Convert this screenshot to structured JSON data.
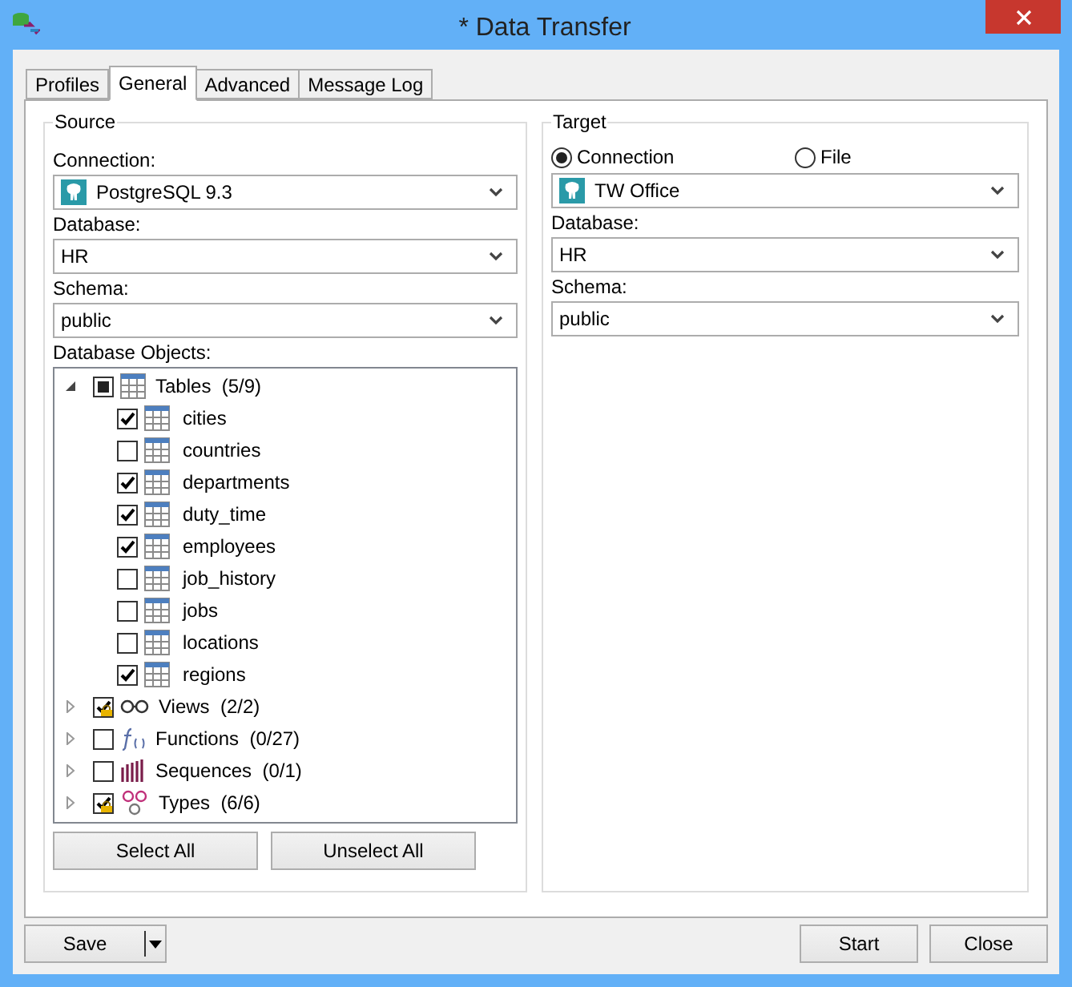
{
  "window": {
    "title": "* Data Transfer"
  },
  "tabs": [
    {
      "label": "Profiles",
      "selected": false
    },
    {
      "label": "General",
      "selected": true
    },
    {
      "label": "Advanced",
      "selected": false
    },
    {
      "label": "Message Log",
      "selected": false
    }
  ],
  "source": {
    "title": "Source",
    "connection_label": "Connection:",
    "connection": "PostgreSQL 9.3",
    "database_label": "Database:",
    "database": "HR",
    "schema_label": "Schema:",
    "schema": "public",
    "objects_label": "Database Objects:",
    "tree": [
      {
        "label": "Tables",
        "count": "(5/9)",
        "kind": "table",
        "checked": false,
        "partial": true,
        "locked": false,
        "expanded": true,
        "children": [
          {
            "label": "cities",
            "checked": true
          },
          {
            "label": "countries",
            "checked": false
          },
          {
            "label": "departments",
            "checked": true
          },
          {
            "label": "duty_time",
            "checked": true
          },
          {
            "label": "employees",
            "checked": true
          },
          {
            "label": "job_history",
            "checked": false
          },
          {
            "label": "jobs",
            "checked": false
          },
          {
            "label": "locations",
            "checked": false
          },
          {
            "label": "regions",
            "checked": true
          }
        ]
      },
      {
        "label": "Views",
        "count": "(2/2)",
        "kind": "view",
        "checked": true,
        "partial": false,
        "locked": true,
        "expanded": false
      },
      {
        "label": "Functions",
        "count": "(0/27)",
        "kind": "function",
        "checked": false,
        "partial": false,
        "locked": false,
        "expanded": false
      },
      {
        "label": "Sequences",
        "count": "(0/1)",
        "kind": "sequence",
        "checked": false,
        "partial": false,
        "locked": false,
        "expanded": false
      },
      {
        "label": "Types",
        "count": "(6/6)",
        "kind": "type",
        "checked": true,
        "partial": false,
        "locked": true,
        "expanded": false
      }
    ],
    "buttons": [
      "Select All",
      "Unselect All"
    ]
  },
  "target": {
    "title": "Target",
    "options": [
      {
        "label": "Connection",
        "selected": true
      },
      {
        "label": "File",
        "selected": false
      }
    ],
    "connection": "TW Office",
    "database_label": "Database:",
    "database": "HR",
    "schema_label": "Schema:",
    "schema": "public"
  },
  "footer": {
    "save": "Save",
    "buttons": [
      "Start",
      "Close"
    ]
  }
}
